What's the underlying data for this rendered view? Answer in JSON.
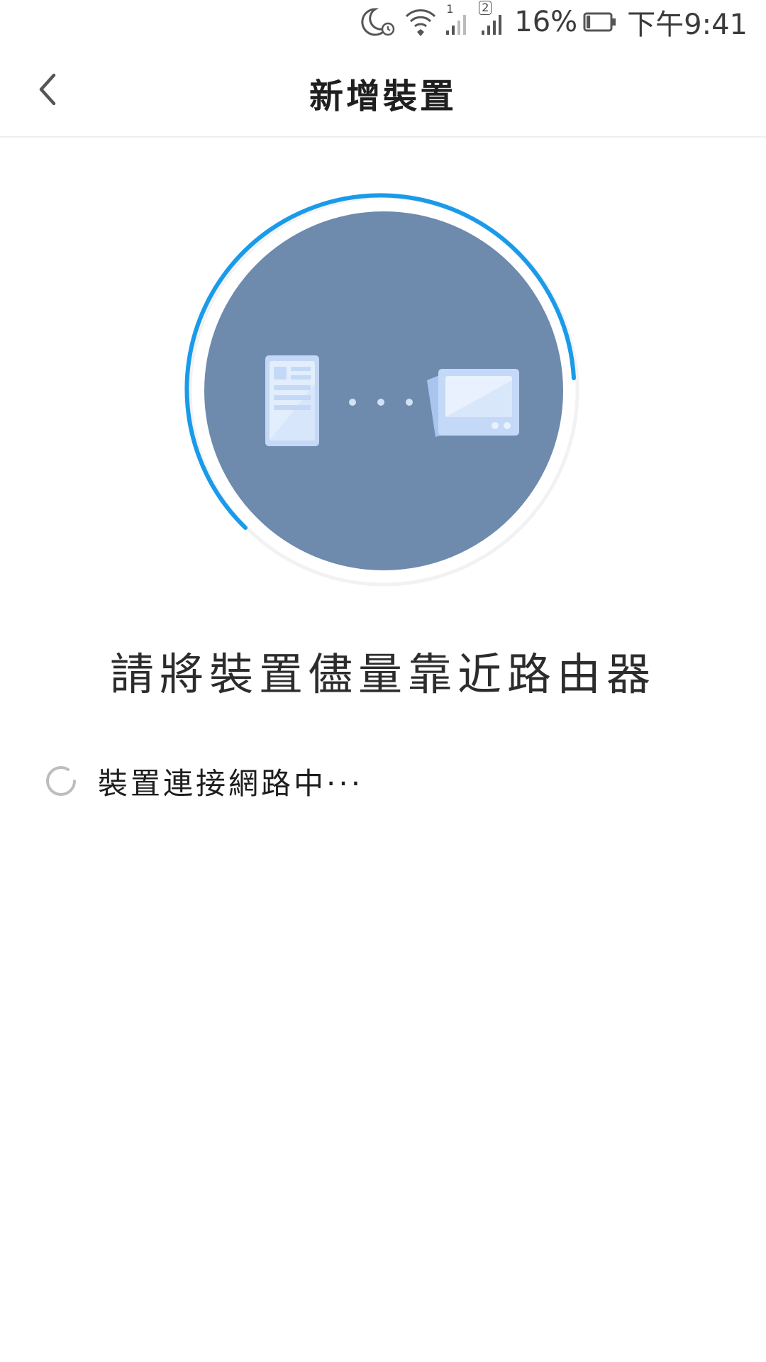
{
  "status_bar": {
    "sim1_label": "1",
    "sim2_label": "2",
    "battery_text": "16%",
    "time_text": "下午9:41",
    "battery_level": 0.16,
    "icons": [
      "moon-alarm-icon",
      "wifi-icon",
      "signal-sim1-icon",
      "signal-sim2-icon",
      "battery-icon"
    ]
  },
  "header": {
    "title": "新增裝置",
    "back_icon": "chevron-left-icon"
  },
  "illustration": {
    "icons": [
      "phone-icon",
      "connection-dots-icon",
      "router-device-icon"
    ],
    "accent_color": "#1a9be9",
    "circle_color": "#6e8aac"
  },
  "main": {
    "prompt": "請將裝置儘量靠近路由器"
  },
  "connection_status": {
    "label": "裝置連接網路中···",
    "icon": "loading-spinner-icon"
  }
}
